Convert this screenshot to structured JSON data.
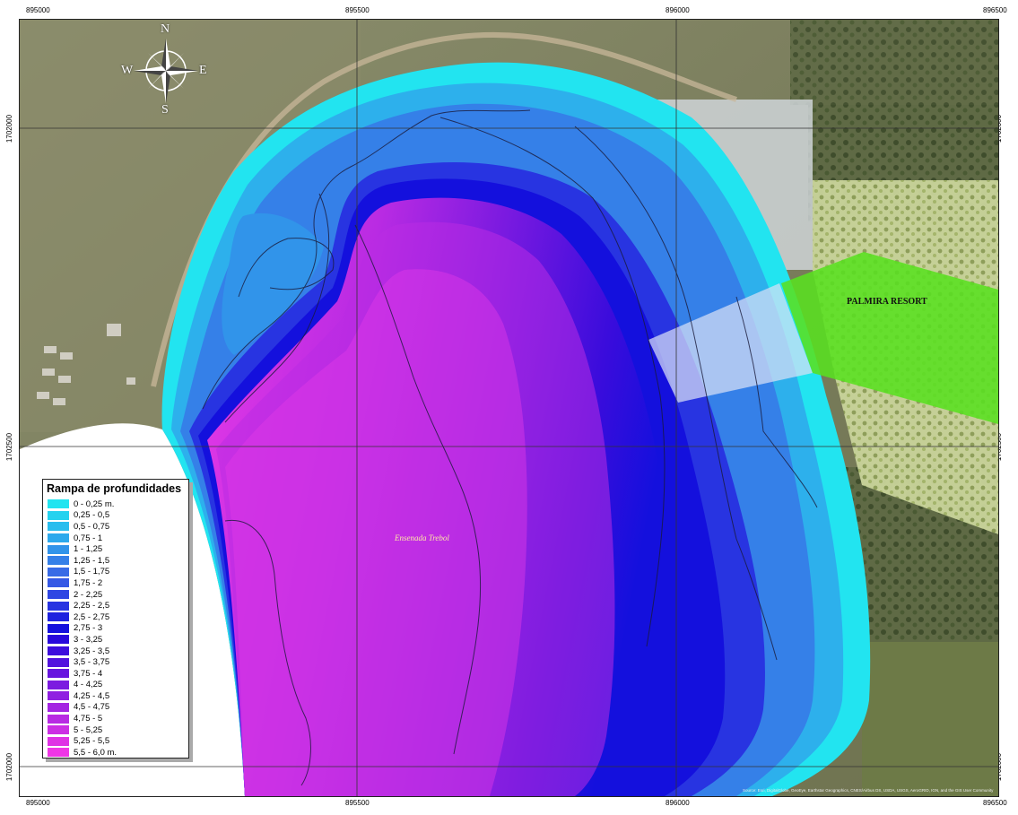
{
  "coords": {
    "top": [
      "895000",
      "895500",
      "896000",
      "896500"
    ],
    "bottom": [
      "895000",
      "895500",
      "896000",
      "896500"
    ],
    "left": [
      "1702000",
      "1702500",
      "1702000"
    ],
    "right": [
      "1702000",
      "1702500",
      "1702000"
    ]
  },
  "compass": {
    "n": "N",
    "s": "S",
    "e": "E",
    "w": "W"
  },
  "labels": {
    "resort": "PALMIRA RESORT",
    "bay": "Ensenada Trebol",
    "attribution": "Source: Esri, DigitalGlobe, GeoEye, Earthstar Geographics, CNES/Airbus DS, USDA, USGS, AeroGRID, IGN, and the GIS User Community"
  },
  "legend": {
    "title": "Rampa de profundidades",
    "items": [
      {
        "label": "0 - 0,25 m.",
        "color": "#22e4f0"
      },
      {
        "label": "0,25 - 0,5",
        "color": "#25d2ef"
      },
      {
        "label": "0,5 - 0,75",
        "color": "#29bdee"
      },
      {
        "label": "0,75 - 1",
        "color": "#2da9ec"
      },
      {
        "label": "1 - 1,25",
        "color": "#3194ea"
      },
      {
        "label": "1,25 - 1,5",
        "color": "#3580e8"
      },
      {
        "label": "1,5 - 1,75",
        "color": "#386be6"
      },
      {
        "label": "1,75 - 2",
        "color": "#3559e5"
      },
      {
        "label": "2 - 2,25",
        "color": "#2f47e3"
      },
      {
        "label": "2,25 - 2,5",
        "color": "#2834e1"
      },
      {
        "label": "2,5 - 2,75",
        "color": "#1e22df"
      },
      {
        "label": "2,75 - 3",
        "color": "#1410dd"
      },
      {
        "label": "3 - 3,25",
        "color": "#2808dc"
      },
      {
        "label": "3,25 - 3,5",
        "color": "#3d0ddd"
      },
      {
        "label": "3,5 - 3,75",
        "color": "#5212de"
      },
      {
        "label": "3,75 - 4",
        "color": "#6716df"
      },
      {
        "label": "4 - 4,25",
        "color": "#7c1be0"
      },
      {
        "label": "4,25 - 4,5",
        "color": "#9020e1"
      },
      {
        "label": "4,5 - 4,75",
        "color": "#a425e2"
      },
      {
        "label": "4,75 - 5",
        "color": "#b82ae3"
      },
      {
        "label": "5 - 5,25",
        "color": "#cc2ee4"
      },
      {
        "label": "5,25 - 5,5",
        "color": "#df32e5"
      },
      {
        "label": "5,5 - 6,0 m.",
        "color": "#ef36e6"
      }
    ]
  }
}
